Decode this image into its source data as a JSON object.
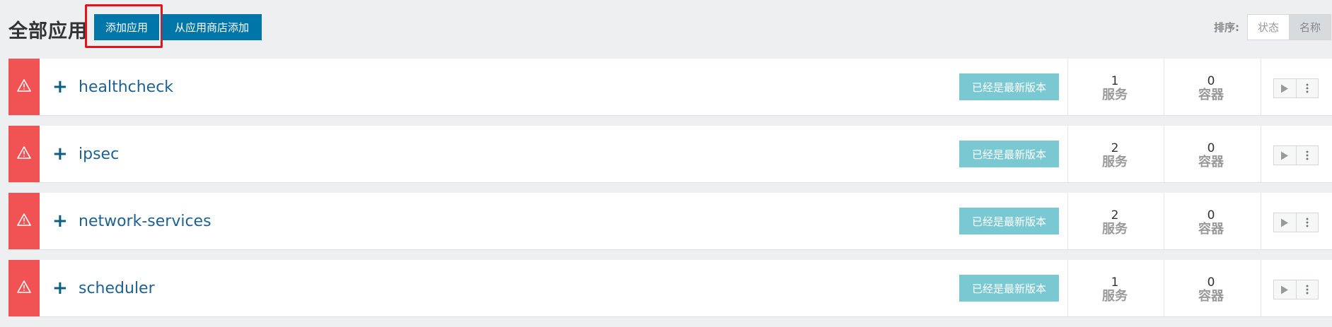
{
  "header": {
    "title": "全部应用",
    "add_button": "添加应用",
    "catalog_button": "从应用商店添加",
    "sort_label": "排序:",
    "sort_options": [
      "状态",
      "名称"
    ],
    "sort_active": "名称"
  },
  "colors": {
    "primary": "#0075a8",
    "alert": "#f15354",
    "badge": "#7ac8d1",
    "highlight": "#e8131a"
  },
  "apps": [
    {
      "name": "healthcheck",
      "status_badge": "已经是最新版本",
      "services_count": "1",
      "services_label": "服务",
      "containers_count": "0",
      "containers_label": "容器"
    },
    {
      "name": "ipsec",
      "status_badge": "已经是最新版本",
      "services_count": "2",
      "services_label": "服务",
      "containers_count": "0",
      "containers_label": "容器"
    },
    {
      "name": "network-services",
      "status_badge": "已经是最新版本",
      "services_count": "2",
      "services_label": "服务",
      "containers_count": "0",
      "containers_label": "容器"
    },
    {
      "name": "scheduler",
      "status_badge": "已经是最新版本",
      "services_count": "1",
      "services_label": "服务",
      "containers_count": "0",
      "containers_label": "容器"
    }
  ],
  "icons": {
    "alert": "warning-icon",
    "expand": "plus-icon",
    "start": "play-icon",
    "menu": "kebab-menu-icon"
  }
}
